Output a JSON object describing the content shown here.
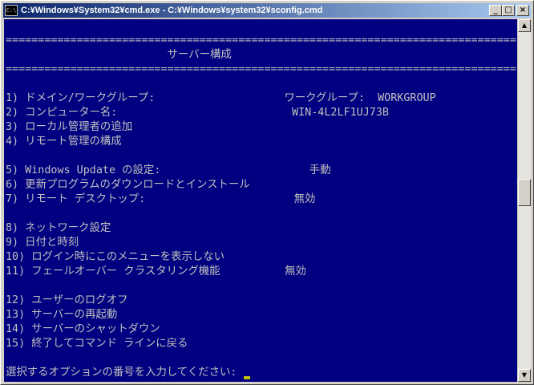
{
  "window": {
    "title": "C:¥Windows¥System32¥cmd.exe - C:¥Windows¥system32¥sconfig.cmd",
    "icon_label": "C:\\"
  },
  "console": {
    "lines": [
      "",
      "===============================================================================",
      "                         サーバー構成",
      "===============================================================================",
      "",
      "1) ドメイン/ワークグループ:                    ワークグループ:  WORKGROUP",
      "2) コンピューター名:                           WIN-4L2LF1UJ73B",
      "3) ローカル管理者の追加",
      "4) リモート管理の構成",
      "",
      "5) Windows Update の設定:                       手動",
      "6) 更新プログラムのダウンロードとインストール",
      "7) リモート デスクトップ:                       無効",
      "",
      "8) ネットワーク設定",
      "9) 日付と時刻",
      "10) ログイン時にこのメニューを表示しない",
      "11) フェールオーバー クラスタリング機能          無効",
      "",
      "12) ユーザーのログオフ",
      "13) サーバーの再起動",
      "14) サーバーのシャットダウン",
      "15) 終了してコマンド ラインに戻る",
      "",
      "選択するオプションの番号を入力してください: "
    ]
  },
  "colors": {
    "console_bg": "#000080",
    "console_fg": "#c0c0c0",
    "titlebar_start": "#0a246a",
    "titlebar_end": "#a6caf0",
    "cursor": "#c0c000"
  },
  "icons": {
    "minimize": "minimize-icon",
    "maximize": "maximize-icon",
    "close": "close-icon",
    "scroll_up": "arrow-up-icon",
    "scroll_down": "arrow-down-icon"
  }
}
